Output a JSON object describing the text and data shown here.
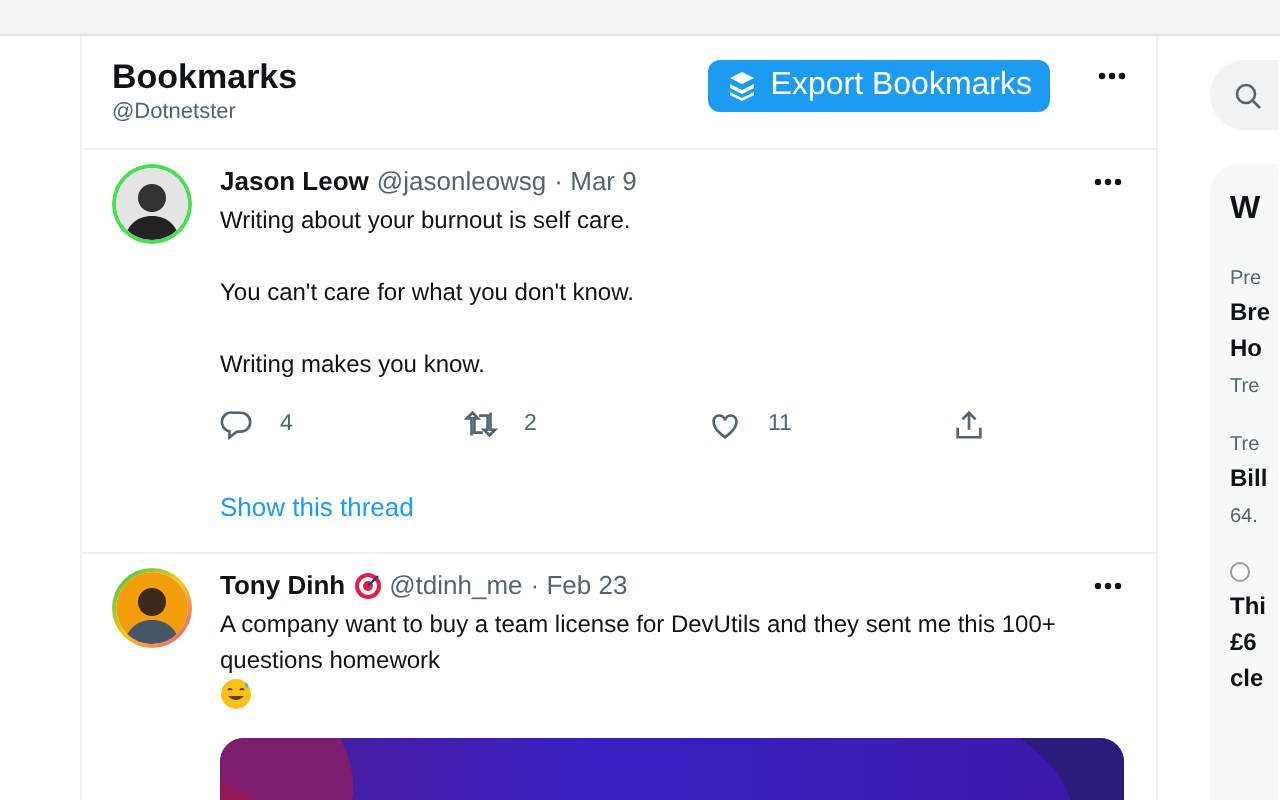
{
  "header": {
    "title": "Bookmarks",
    "handle": "@Dotnetster",
    "export_button": "Export Bookmarks"
  },
  "tweets": [
    {
      "name": "Jason Leow",
      "badge": false,
      "handle": "@jasonleowsg",
      "date": "· Mar 9",
      "paragraphs": [
        "Writing about your burnout is self care.",
        "You can't care for what you don't know.",
        "Writing makes you know."
      ],
      "trailing_emoji": false,
      "stats": {
        "replies": "4",
        "retweets": "2",
        "likes": "11"
      },
      "thread_link": "Show this thread",
      "media": false
    },
    {
      "name": "Tony Dinh",
      "badge": true,
      "handle": "@tdinh_me",
      "date": "· Feb 23",
      "paragraphs": [
        "A company want to buy a team license for DevUtils and they sent me this 100+ questions homework"
      ],
      "trailing_emoji": true,
      "media": true
    }
  ],
  "sidebar": {
    "card_title": "W",
    "items": [
      {
        "meta": "Pre",
        "lines": [
          "Bre",
          "Ho"
        ],
        "foot": "Tre"
      },
      {
        "meta": "Tre",
        "lines": [
          "Bill"
        ],
        "foot": "64."
      },
      {
        "lines": [
          "Thi",
          "£6",
          "cle"
        ]
      }
    ]
  }
}
